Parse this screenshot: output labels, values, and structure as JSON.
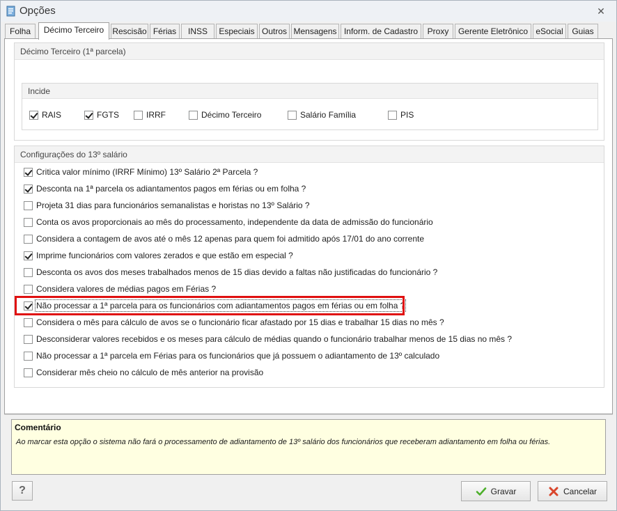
{
  "window": {
    "title": "Opções",
    "close_glyph": "✕"
  },
  "tabs": [
    {
      "label": "Folha"
    },
    {
      "label": "Décimo Terceiro",
      "active": true
    },
    {
      "label": "Rescisão"
    },
    {
      "label": "Férias"
    },
    {
      "label": "INSS"
    },
    {
      "label": "Especiais"
    },
    {
      "label": "Outros"
    },
    {
      "label": "Mensagens"
    },
    {
      "label": "Inform. de Cadastro"
    },
    {
      "label": "Proxy"
    },
    {
      "label": "Gerente Eletrônico"
    },
    {
      "label": "eSocial"
    },
    {
      "label": "Guias"
    }
  ],
  "group1": {
    "title": "Décimo Terceiro (1ª parcela)",
    "incide": {
      "title": "Incide",
      "options": [
        {
          "label": "RAIS",
          "checked": true
        },
        {
          "label": "FGTS",
          "checked": true
        },
        {
          "label": "IRRF",
          "checked": false
        },
        {
          "label": "Décimo Terceiro",
          "checked": false
        },
        {
          "label": "Salário Família",
          "checked": false
        },
        {
          "label": "PIS",
          "checked": false
        }
      ]
    }
  },
  "group2": {
    "title": "Configurações do 13º salário",
    "options": [
      {
        "label": "Critica valor mínimo (IRRF Mínimo) 13º Salário 2ª Parcela ?",
        "checked": true
      },
      {
        "label": "Desconta na 1ª parcela os adiantamentos pagos em férias ou em folha ?",
        "checked": true
      },
      {
        "label": "Projeta 31 dias para funcionários semanalistas e horistas no 13º Salário ?",
        "checked": false
      },
      {
        "label": "Conta os avos proporcionais ao mês do processamento, independente da data de admissão do funcionário",
        "checked": false
      },
      {
        "label": "Considera a contagem de avos até o mês 12 apenas para quem foi admitido após 17/01 do ano corrente",
        "checked": false
      },
      {
        "label": "Imprime funcionários com valores zerados e que estão em especial ?",
        "checked": true
      },
      {
        "label": "Desconta os avos dos meses trabalhados menos de 15 dias devido a faltas não justificadas do funcionário ?",
        "checked": false
      },
      {
        "label": "Considera valores de médias pagos em Férias ?",
        "checked": false
      },
      {
        "label": "Não processar a 1ª parcela para os funcionários com adiantamentos pagos em férias ou em folha ?",
        "checked": true,
        "highlighted": true
      },
      {
        "label": "Considera o mês para cálculo de avos se o funcionário ficar afastado por 15 dias e trabalhar 15 dias no mês ?",
        "checked": false
      },
      {
        "label": "Desconsiderar valores recebidos e os meses para cálculo de médias quando o funcionário trabalhar menos de 15 dias no mês ?",
        "checked": false
      },
      {
        "label": "Não processar a 1ª parcela em Férias para os funcionários que já possuem o adiantamento de 13º calculado",
        "checked": false
      },
      {
        "label": "Considerar mês cheio no cálculo de mês anterior na provisão",
        "checked": false
      }
    ]
  },
  "comment": {
    "title": "Comentário",
    "text": "Ao marcar esta opção o sistema não fará o processamento de adiantamento de 13º salário dos funcionários que receberam adiantamento em folha ou férias."
  },
  "buttons": {
    "help": "?",
    "save": "Gravar",
    "cancel": "Cancelar"
  },
  "colors": {
    "highlight": "#e01010",
    "comment_bg": "#ffffe1",
    "save_icon": "#4caf2a",
    "cancel_icon": "#d9452b"
  }
}
